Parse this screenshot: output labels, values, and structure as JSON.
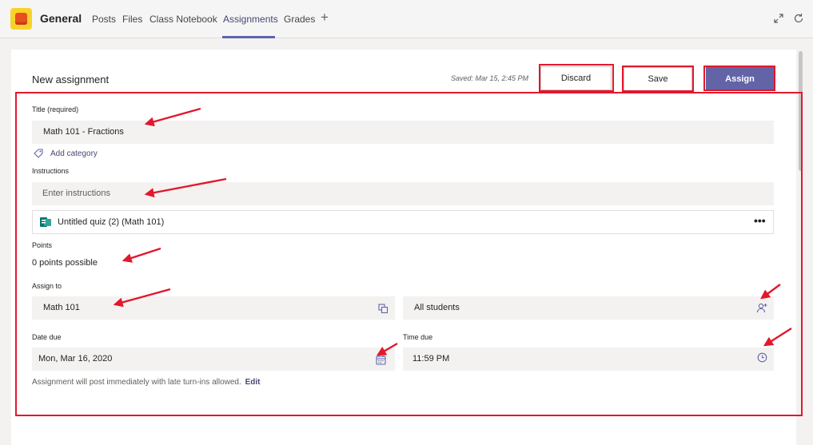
{
  "header": {
    "team_name": "General",
    "tabs": [
      {
        "label": "Posts"
      },
      {
        "label": "Files"
      },
      {
        "label": "Class Notebook"
      },
      {
        "label": "Assignments"
      },
      {
        "label": "Grades"
      }
    ],
    "active_tab": "Assignments",
    "add_tab_glyph": "+",
    "icons": [
      "expand-icon",
      "refresh-icon"
    ]
  },
  "assignment": {
    "heading": "New assignment",
    "saved_status": "Saved: Mar 15, 2:45 PM",
    "buttons": {
      "discard": "Discard",
      "save": "Save",
      "assign": "Assign"
    },
    "title_label": "Title (required)",
    "title_value": "Math 101 - Fractions",
    "add_category": "Add category",
    "instructions_label": "Instructions",
    "instructions_placeholder": "Enter instructions",
    "attachment": {
      "name": "Untitled quiz (2) (Math 101)",
      "more_glyph": "•••"
    },
    "points_label": "Points",
    "points_value": "0 points possible",
    "assign_to_label": "Assign to",
    "class_value": "Math 101",
    "students_value": "All students",
    "date_due_label": "Date due",
    "date_due_value": "Mon, Mar 16, 2020",
    "time_due_label": "Time due",
    "time_due_value": "11:59 PM",
    "post_note": "Assignment will post immediately with late turn-ins allowed.",
    "edit_link": "Edit"
  },
  "colors": {
    "accent": "#6264a7",
    "annotation_red": "#e3172d",
    "field_bg": "#f3f2f1",
    "app_tile": "#f8d22a",
    "app_tile_inner": "#e6501e",
    "forms_green": "#077568"
  }
}
